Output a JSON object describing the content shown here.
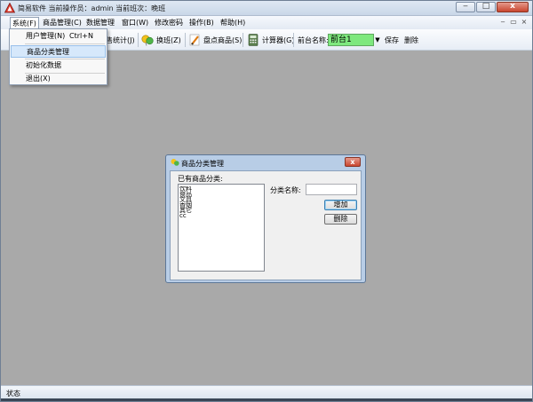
{
  "window": {
    "title": "简易软件 当前操作员：admin 当前班次：晚班",
    "controls": [
      "‒",
      "□",
      "x"
    ]
  },
  "menubar": {
    "items": [
      {
        "label": "系统(F)"
      },
      {
        "label": "商品管理(C)"
      },
      {
        "label": "数据管理"
      },
      {
        "label": "窗口(W)"
      },
      {
        "label": "修改密码"
      },
      {
        "label": "操作(B)"
      },
      {
        "label": "帮助(H)"
      }
    ],
    "mdi_controls": [
      "‒",
      "▭",
      "×"
    ]
  },
  "system_menu": {
    "items": [
      {
        "label": "用户管理(N)",
        "shortcut": "Ctrl+N"
      },
      {
        "label": "商品分类管理",
        "shortcut": ""
      },
      {
        "label": "初始化数据",
        "shortcut": ""
      },
      {
        "label": "退出(X)",
        "shortcut": ""
      }
    ]
  },
  "toolbar": {
    "stats_label": "售统计(J)",
    "shift_label": "换班(Z)",
    "order_label": "盘点商品(S)",
    "calc_label": "计算器(G)",
    "front_name_label": "前台名称:",
    "front_name_value": "前台1",
    "save_label": "保存",
    "delete_label": "删除"
  },
  "dialog": {
    "title": "商品分类管理",
    "close_label": "x",
    "existing_label": "已有商品分类:",
    "categories": [
      "饮料",
      "食品",
      "文具",
      "香烟",
      "其它",
      "cc"
    ],
    "name_label": "分类名称:",
    "name_value": "",
    "add_label": "增加",
    "delete_label": "删除"
  },
  "statusbar": {
    "text": "状态"
  },
  "colors": {
    "workspace": "#a9a9a9",
    "combo_green": "#7ee87e",
    "dialog_frame": "#b8cde6",
    "highlight": "#d6e8fb"
  }
}
